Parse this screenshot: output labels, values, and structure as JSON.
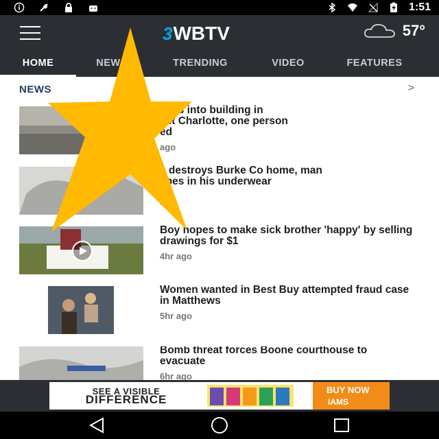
{
  "status_bar": {
    "time": "1:51",
    "icons_left": [
      "info-icon",
      "no-gps-icon",
      "lock-icon",
      "android-icon"
    ],
    "icons_right": [
      "bluetooth-icon",
      "wifi-icon",
      "no-signal-icon",
      "battery-charging-icon"
    ]
  },
  "app_bar": {
    "menu_icon": "hamburger-menu-icon",
    "logo": "WBTV",
    "logo_prefix": "3",
    "weather": {
      "icon": "cloud-icon",
      "temperature": "57°"
    },
    "tabs": [
      {
        "label": "HOME",
        "active": true
      },
      {
        "label": "NEWS",
        "active": false
      },
      {
        "label": "TRENDING",
        "active": false
      },
      {
        "label": "VIDEO",
        "active": false
      },
      {
        "label": "FEATURES",
        "active": false
      }
    ]
  },
  "section": {
    "title": "NEWS",
    "arrow": ">"
  },
  "articles": [
    {
      "headline": "shes into building in\nast Charlotte, one person\ned",
      "age": "ago"
    },
    {
      "headline": "e destroys Burke Co home, man\napes in his underwear",
      "age": "ago"
    },
    {
      "headline": "Boy hopes to make sick brother 'happy' by selling drawings for $1",
      "age": "4hr ago"
    },
    {
      "headline": "Women wanted in Best Buy attempted fraud case in Matthews",
      "age": "5hr ago"
    },
    {
      "headline": "Bomb threat forces Boone courthouse to evacuate",
      "age": "6hr ago"
    }
  ],
  "ad": {
    "line1": "SEE A VISIBLE",
    "line2": "DIFFERENCE",
    "cta": "BUY NOW",
    "brand": "IAMS"
  },
  "nav_bar": {
    "buttons": [
      "back-icon",
      "home-icon",
      "recents-icon"
    ]
  },
  "overlay": {
    "shape": "star",
    "color": "#ffb900"
  },
  "colors": {
    "app_bar": "#2b2e33",
    "accent": "#00a8e0",
    "section_title": "#1f3c62"
  }
}
